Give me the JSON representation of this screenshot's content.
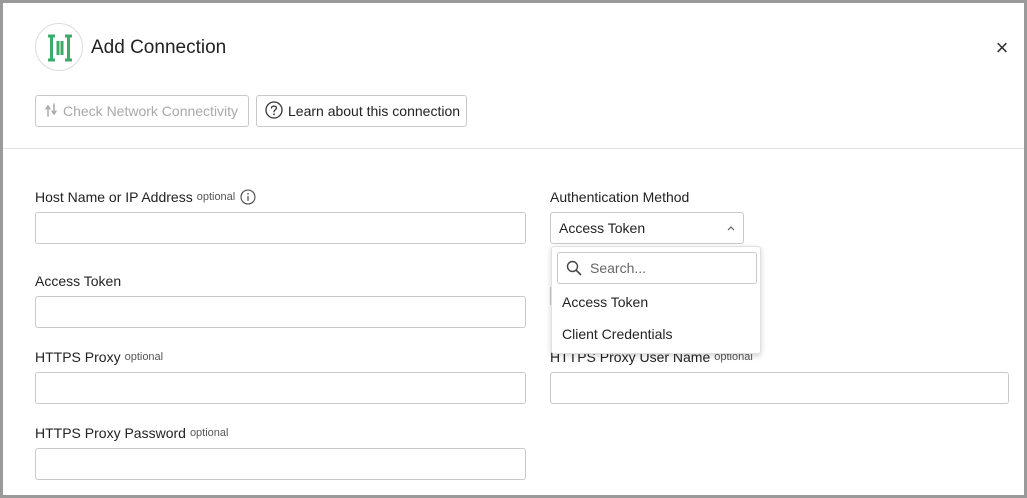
{
  "dialog": {
    "title": "Add Connection",
    "close_label": "×"
  },
  "toolbar": {
    "check_label": "Check Network Connectivity",
    "learn_label": "Learn about this connection"
  },
  "fields": {
    "host": {
      "label": "Host Name or IP Address",
      "optional": "optional",
      "value": ""
    },
    "access_token": {
      "label": "Access Token",
      "value": ""
    },
    "https_proxy": {
      "label": "HTTPS Proxy",
      "optional": "optional",
      "value": ""
    },
    "https_proxy_user": {
      "label": "HTTPS Proxy User Name",
      "optional": "optional",
      "value": ""
    },
    "https_proxy_password": {
      "label": "HTTPS Proxy Password",
      "optional": "optional",
      "value": ""
    }
  },
  "auth": {
    "label": "Authentication Method",
    "selected": "Access Token",
    "search_placeholder": "Search...",
    "options": [
      "Access Token",
      "Client Credentials"
    ]
  },
  "colors": {
    "brand_green": "#3daa6a",
    "border": "#c9c9c9",
    "disabled_text": "#a9a9a9"
  }
}
